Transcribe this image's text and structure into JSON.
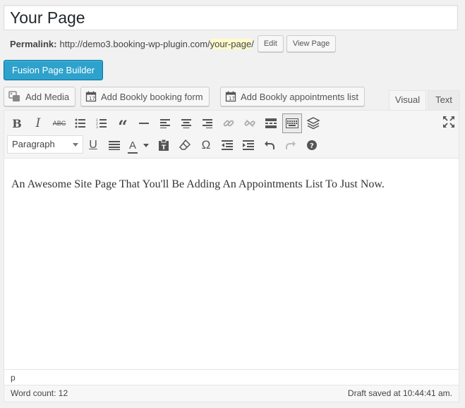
{
  "post": {
    "title": "Your Page",
    "permalink_label": "Permalink:",
    "permalink_base": "http://demo3.booking-wp-plugin.com/",
    "permalink_slug": "your-page",
    "permalink_suffix": "/",
    "edit_label": "Edit",
    "view_label": "View Page"
  },
  "fusion": {
    "label": "Fusion Page Builder"
  },
  "media_buttons": [
    {
      "label": "Add Media",
      "icon": "media-icon"
    },
    {
      "label": "Add Bookly booking form",
      "icon": "calendar-icon"
    },
    {
      "label": "Add Bookly appointments list",
      "icon": "calendar-icon"
    }
  ],
  "tabs": {
    "visual": "Visual",
    "text": "Text",
    "active": "Visual"
  },
  "toolbar": {
    "format": "Paragraph",
    "row1": [
      "bold-icon",
      "italic-icon",
      "strikethrough-icon",
      "bullet-list-icon",
      "numbered-list-icon",
      "blockquote-icon",
      "horizontal-rule-icon",
      "align-left-icon",
      "align-center-icon",
      "align-right-icon",
      "link-icon",
      "unlink-icon",
      "read-more-icon",
      "toolbar-toggle-icon",
      "layers-icon"
    ],
    "row2": [
      "underline-icon",
      "justify-icon",
      "text-color-icon",
      "paste-text-icon",
      "clear-formatting-icon",
      "special-character-icon",
      "outdent-icon",
      "indent-icon",
      "undo-icon",
      "redo-icon",
      "help-icon"
    ]
  },
  "content": {
    "text": "An Awesome Site Page That You'll Be Adding An Appointments List To Just Now."
  },
  "path": {
    "text": "p"
  },
  "status": {
    "word_count": "Word count: 12",
    "draft_saved": "Draft saved at 10:44:41 am."
  },
  "colors": {
    "accent": "#2ea2cc",
    "slug_highlight": "#fffbcc"
  }
}
